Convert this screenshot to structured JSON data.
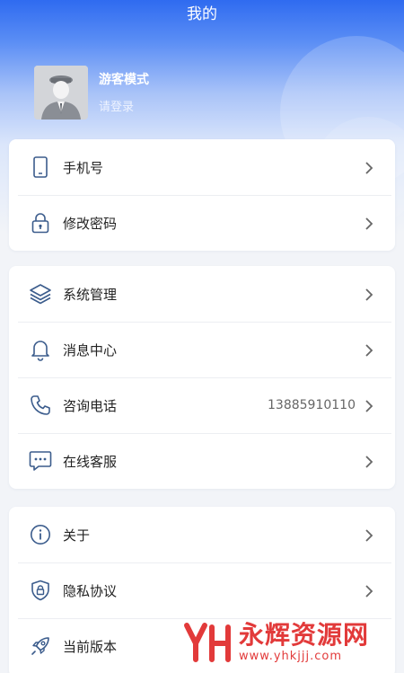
{
  "header": {
    "title": "我的"
  },
  "profile": {
    "name": "游客模式",
    "subtitle": "请登录"
  },
  "groups": [
    {
      "items": [
        {
          "label": "手机号",
          "icon": "phone-icon"
        },
        {
          "label": "修改密码",
          "icon": "lock-icon"
        }
      ]
    },
    {
      "items": [
        {
          "label": "系统管理",
          "icon": "layers-icon"
        },
        {
          "label": "消息中心",
          "icon": "bell-icon"
        },
        {
          "label": "咨询电话",
          "icon": "telephone-icon",
          "value": "13885910110"
        },
        {
          "label": "在线客服",
          "icon": "chat-icon"
        }
      ]
    },
    {
      "items": [
        {
          "label": "关于",
          "icon": "info-icon"
        },
        {
          "label": "隐私协议",
          "icon": "shield-icon"
        },
        {
          "label": "当前版本",
          "icon": "rocket-icon"
        }
      ]
    }
  ],
  "watermark": {
    "text": "永辉资源网",
    "url": "www.yhkjjj.com"
  },
  "colors": {
    "accent": "#2f6bf0",
    "icon": "#3b5c8c",
    "watermark": "#e23a3a"
  }
}
